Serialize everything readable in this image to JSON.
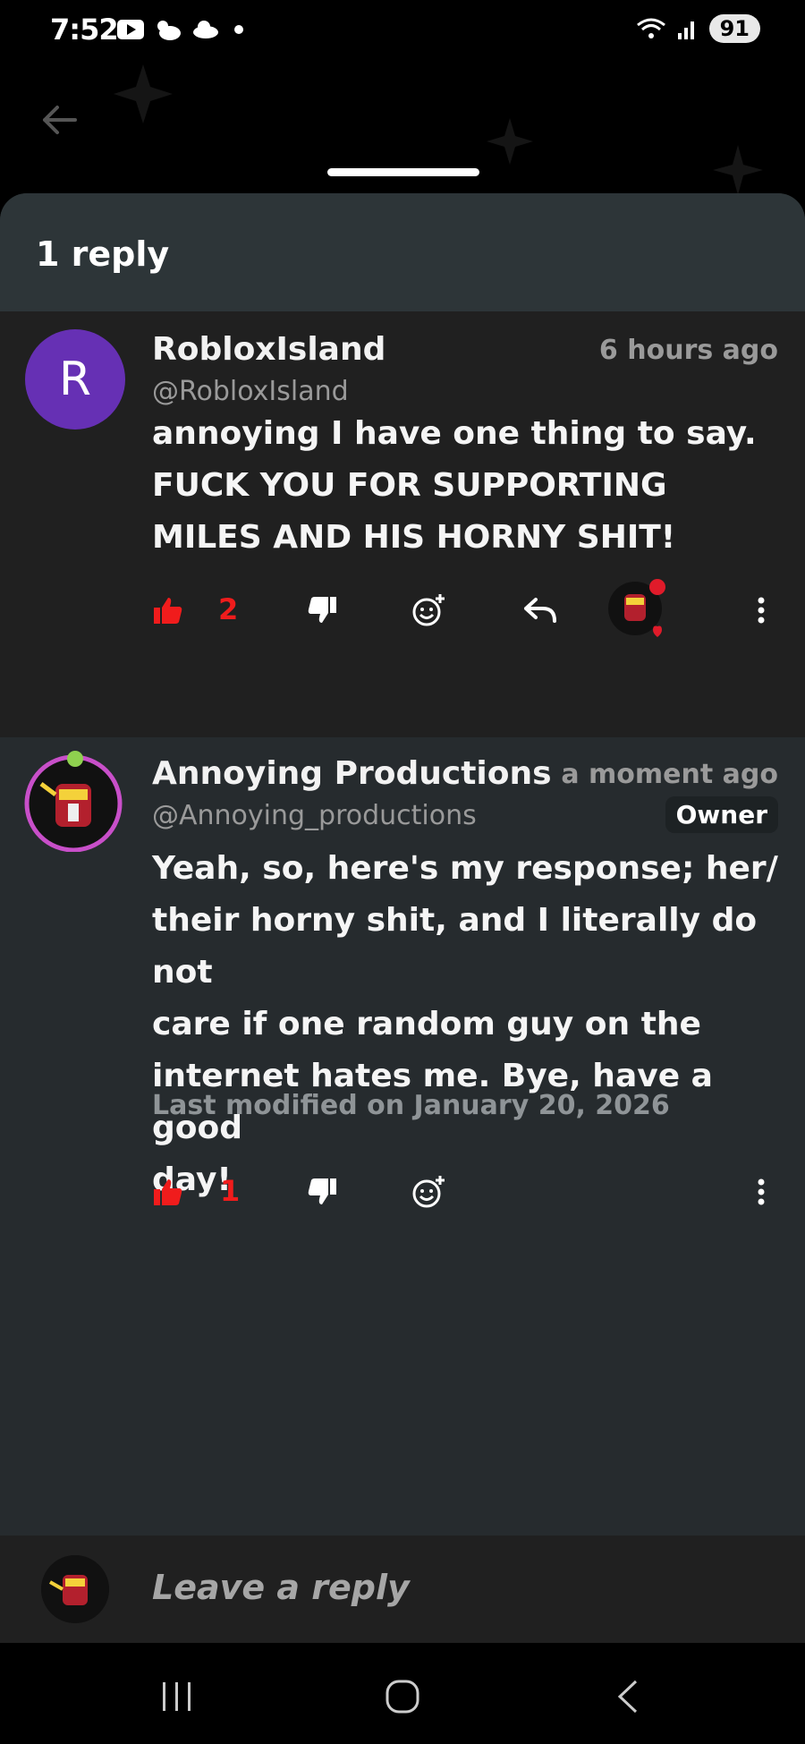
{
  "status": {
    "time": "7:52",
    "battery": "91"
  },
  "sheet": {
    "title": "1 reply"
  },
  "parent_comment": {
    "avatar_letter": "R",
    "author": "RobloxIsland",
    "handle": "@RobloxIsland",
    "time": "6 hours ago",
    "text": "annoying I have one thing to say.\nFUCK YOU FOR SUPPORTING\nMILES AND HIS HORNY SHIT!",
    "likes": "2"
  },
  "reply_comment": {
    "author": "Annoying Productions",
    "handle": "@Annoying_productions",
    "time": "a moment ago",
    "badge": "Owner",
    "text": "Yeah, so, here's my response; her/\ntheir horny shit, and I literally do not\ncare if one random guy on the\ninternet hates me. Bye, have a good\nday!",
    "modified": "Last modified on January 20, 2026",
    "likes": "1"
  },
  "reply_bar": {
    "placeholder": "Leave a reply"
  },
  "colors": {
    "accent_like": "#f01c1c",
    "avatar_purple": "#6630b4",
    "sheet_bg": "#252a2d"
  },
  "icons": [
    "back-arrow-icon",
    "thumbs-up-icon",
    "thumbs-down-icon",
    "add-reaction-icon",
    "reply-icon",
    "more-icon",
    "recents-icon",
    "home-icon",
    "nav-back-icon"
  ]
}
